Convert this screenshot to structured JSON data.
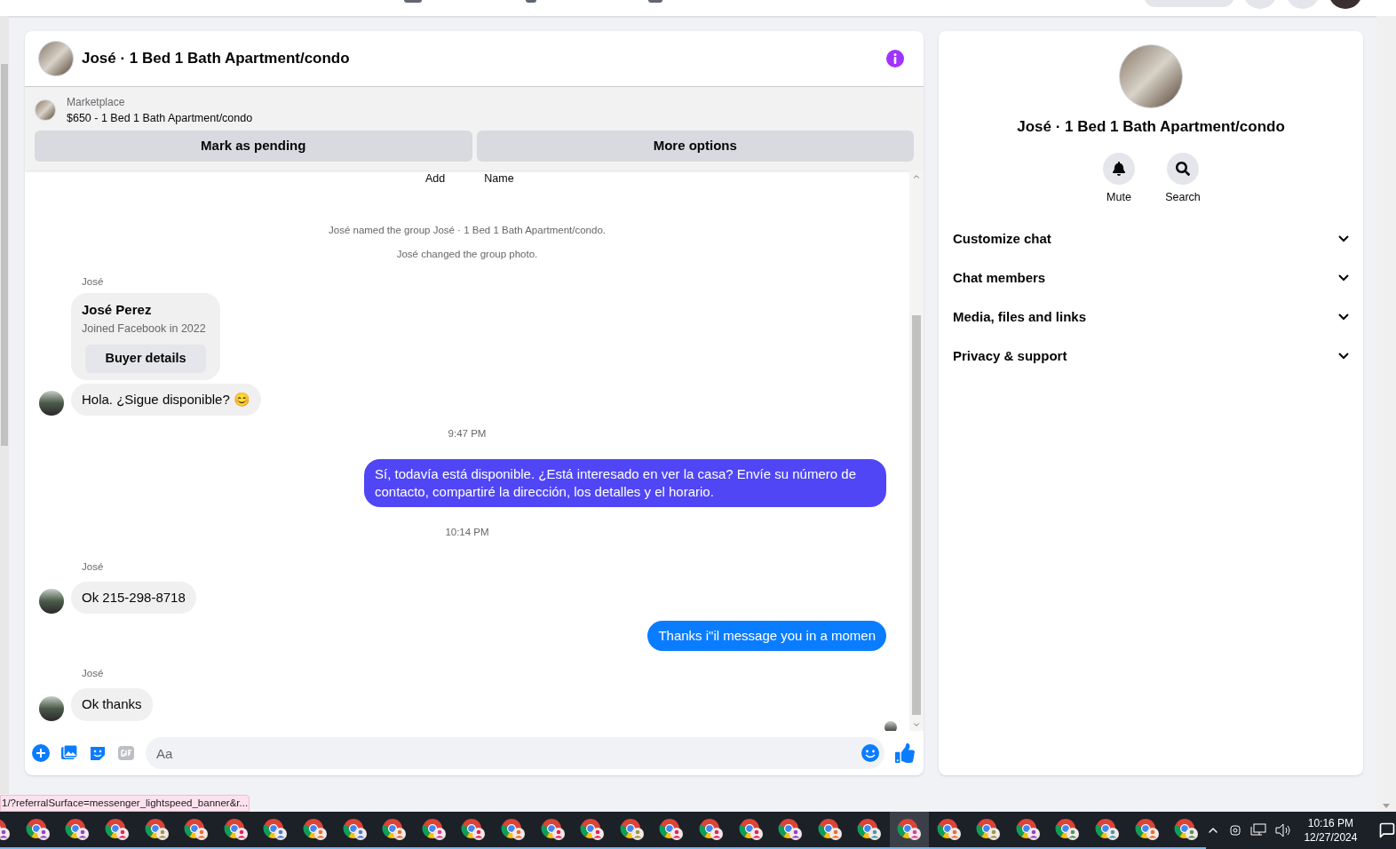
{
  "chat": {
    "title": "José · 1 Bed 1 Bath Apartment/condo",
    "listing": {
      "source": "Marketplace",
      "title": "$650 - 1 Bed 1 Bath Apartment/condo"
    },
    "actions": [
      "Mark as pending",
      "More options"
    ],
    "top_actions": [
      "Add",
      "Name"
    ],
    "messages": [
      {
        "kind": "system",
        "text": "José named the group José · 1 Bed 1 Bath Apartment/condo."
      },
      {
        "kind": "system",
        "text": "José changed the group photo."
      },
      {
        "kind": "sender",
        "text": "José"
      },
      {
        "kind": "card",
        "name": "José Perez",
        "subtitle": "Joined Facebook in 2022",
        "button": "Buyer details"
      },
      {
        "kind": "incoming",
        "text": "Hola. ¿Sigue disponible? 😊",
        "avatar": true
      },
      {
        "kind": "time",
        "text": "9:47 PM"
      },
      {
        "kind": "outgoing",
        "text": "Sí, todavía está disponible. ¿Está interesado en ver la casa? Envíe su número de contacto, compartiré la dirección, los detalles y el horario.",
        "color": "#5046f5"
      },
      {
        "kind": "time",
        "text": "10:14 PM"
      },
      {
        "kind": "sender",
        "text": "José"
      },
      {
        "kind": "incoming",
        "text": "Ok 215-298-8718",
        "avatar": true
      },
      {
        "kind": "outgoing",
        "text": "Thanks i\"il message you in a momen",
        "color": "#0a7cff"
      },
      {
        "kind": "sender",
        "text": "José"
      },
      {
        "kind": "incoming",
        "text": "Ok thanks",
        "avatar": true
      }
    ],
    "composer": {
      "placeholder": "Aa"
    }
  },
  "details": {
    "title": "José · 1 Bed 1 Bath Apartment/condo",
    "actions": [
      "Mute",
      "Search"
    ],
    "sections": [
      {
        "label": "Customize chat",
        "expanded": false
      },
      {
        "label": "Chat members",
        "expanded": false
      },
      {
        "label": "Media, files and links",
        "expanded": false
      },
      {
        "label": "Privacy & support",
        "expanded": false
      }
    ]
  },
  "status_link": "1/?referralSurface=messenger_lightspeed_banner&r...",
  "taskbar": {
    "apps": [
      {
        "color": "#8e44c9",
        "selected": false
      },
      {
        "color": "#8e44c9",
        "selected": false
      },
      {
        "color": "#8e44c9",
        "selected": false
      },
      {
        "color": "#e0245e",
        "selected": false
      },
      {
        "color": "#9a9a45",
        "selected": false
      },
      {
        "color": "#e8702a",
        "selected": false
      },
      {
        "color": "#e0245e",
        "selected": false
      },
      {
        "color": "#3b7fd9",
        "selected": false
      },
      {
        "color": "#e8702a",
        "selected": false
      },
      {
        "color": "#3b7fd9",
        "selected": false
      },
      {
        "color": "#e8702a",
        "selected": false
      },
      {
        "color": "#d6409f",
        "selected": false
      },
      {
        "color": "#e0245e",
        "selected": false
      },
      {
        "color": "#e8702a",
        "selected": false
      },
      {
        "color": "#e0245e",
        "selected": false
      },
      {
        "color": "#e0245e",
        "selected": false
      },
      {
        "color": "#9a9a45",
        "selected": false
      },
      {
        "color": "#e0245e",
        "selected": false
      },
      {
        "color": "#e0245e",
        "selected": false
      },
      {
        "color": "#e0245e",
        "selected": false
      },
      {
        "color": "#8e44c9",
        "selected": false
      },
      {
        "color": "#e8702a",
        "selected": false
      },
      {
        "color": "#3aa0a8",
        "selected": false
      },
      {
        "color": "#d6409f",
        "selected": true
      },
      {
        "color": "#e8702a",
        "selected": false
      },
      {
        "color": "#9a9a45",
        "selected": false
      },
      {
        "color": "#8e44c9",
        "selected": false
      },
      {
        "color": "#4a9a5a",
        "selected": false
      },
      {
        "color": "#3aa0a8",
        "selected": false
      },
      {
        "color": "#e8702a",
        "selected": false
      },
      {
        "color": "#4a9a5a",
        "selected": false
      }
    ],
    "time": "10:16 PM",
    "date": "12/27/2024"
  }
}
